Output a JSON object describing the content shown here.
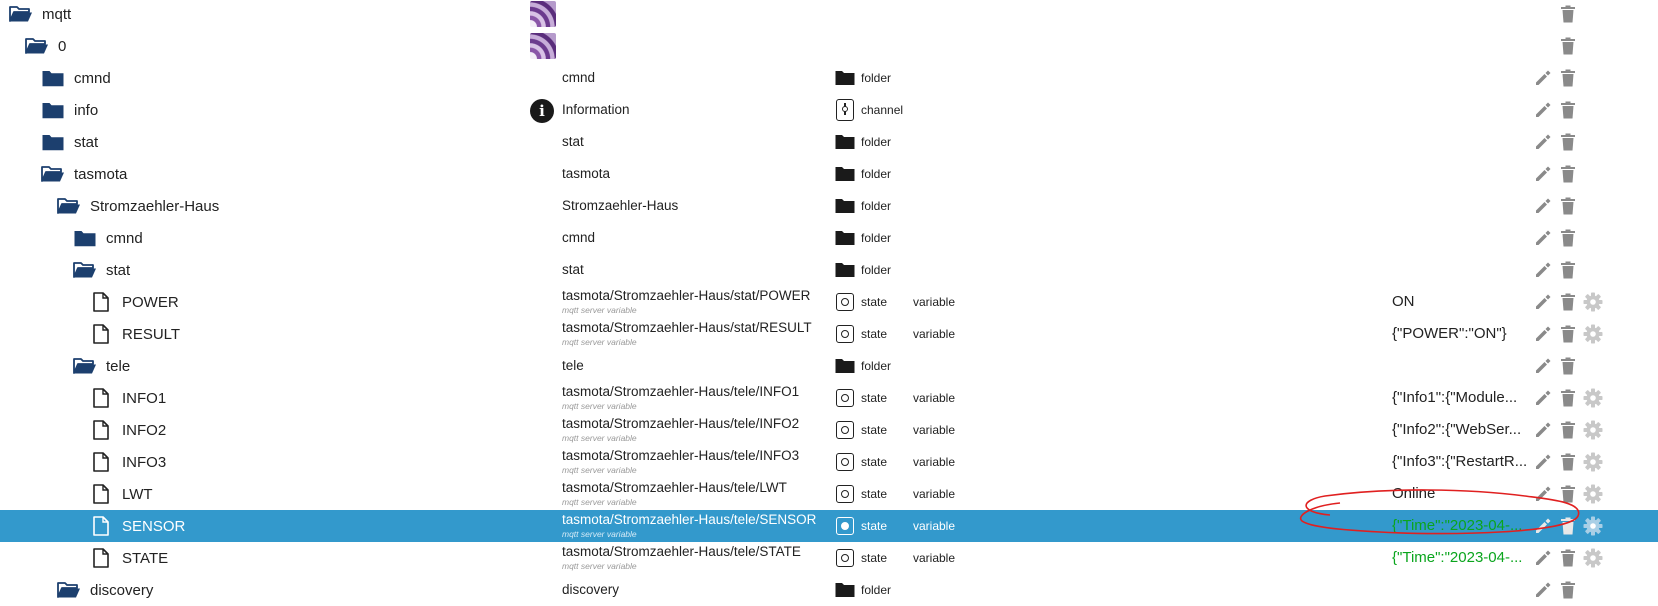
{
  "colors": {
    "folder": "#1c3f6e",
    "selected_row": "#3399cc",
    "value_green": "#0aa51d",
    "action_icon": "#8a8a8a",
    "gear_icon": "#c8c8c8",
    "annotation_red": "#e02020"
  },
  "rows": [
    {
      "id": "mqtt",
      "level": 0,
      "icon": "folder-open-icon",
      "name": "mqtt",
      "obj": {
        "kind": "adapter-image"
      },
      "actions": [
        "delete"
      ]
    },
    {
      "id": "mqtt-0",
      "level": 1,
      "icon": "folder-open-icon",
      "name": "0",
      "obj": {
        "kind": "adapter-image"
      },
      "actions": [
        "delete"
      ]
    },
    {
      "id": "cmnd",
      "level": 2,
      "icon": "folder-icon",
      "name": "cmnd",
      "obj": {
        "kind": "text",
        "name": "cmnd"
      },
      "type": {
        "icon": "folder",
        "label": "folder"
      },
      "actions": [
        "edit",
        "delete"
      ]
    },
    {
      "id": "info",
      "level": 2,
      "icon": "folder-icon",
      "name": "info",
      "obj": {
        "kind": "info",
        "name": "Information"
      },
      "type": {
        "icon": "channel",
        "label": "channel"
      },
      "actions": [
        "edit",
        "delete"
      ]
    },
    {
      "id": "stat",
      "level": 2,
      "icon": "folder-icon",
      "name": "stat",
      "obj": {
        "kind": "text",
        "name": "stat"
      },
      "type": {
        "icon": "folder",
        "label": "folder"
      },
      "actions": [
        "edit",
        "delete"
      ]
    },
    {
      "id": "tasmota",
      "level": 2,
      "icon": "folder-open-icon",
      "name": "tasmota",
      "obj": {
        "kind": "text",
        "name": "tasmota"
      },
      "type": {
        "icon": "folder",
        "label": "folder"
      },
      "actions": [
        "edit",
        "delete"
      ]
    },
    {
      "id": "sz-haus",
      "level": 3,
      "icon": "folder-open-icon",
      "name": "Stromzaehler-Haus",
      "obj": {
        "kind": "text",
        "name": "Stromzaehler-Haus"
      },
      "type": {
        "icon": "folder",
        "label": "folder"
      },
      "actions": [
        "edit",
        "delete"
      ]
    },
    {
      "id": "sz-cmnd",
      "level": 4,
      "icon": "folder-icon",
      "name": "cmnd",
      "obj": {
        "kind": "text",
        "name": "cmnd"
      },
      "type": {
        "icon": "folder",
        "label": "folder"
      },
      "actions": [
        "edit",
        "delete"
      ]
    },
    {
      "id": "sz-stat",
      "level": 4,
      "icon": "folder-open-icon",
      "name": "stat",
      "obj": {
        "kind": "text",
        "name": "stat"
      },
      "type": {
        "icon": "folder",
        "label": "folder"
      },
      "actions": [
        "edit",
        "delete"
      ]
    },
    {
      "id": "power",
      "level": 5,
      "icon": "file-icon",
      "name": "POWER",
      "obj": {
        "kind": "state",
        "name": "tasmota/Stromzaehler-Haus/stat/POWER",
        "sub": "mqtt server variable"
      },
      "type": {
        "icon": "state",
        "label": "state"
      },
      "role": "variable",
      "value": "ON",
      "green": false,
      "actions": [
        "edit",
        "delete",
        "settings"
      ]
    },
    {
      "id": "result",
      "level": 5,
      "icon": "file-icon",
      "name": "RESULT",
      "obj": {
        "kind": "state",
        "name": "tasmota/Stromzaehler-Haus/stat/RESULT",
        "sub": "mqtt server variable"
      },
      "type": {
        "icon": "state",
        "label": "state"
      },
      "role": "variable",
      "value": "{\"POWER\":\"ON\"}",
      "green": false,
      "actions": [
        "edit",
        "delete",
        "settings"
      ]
    },
    {
      "id": "tele",
      "level": 4,
      "icon": "folder-open-icon",
      "name": "tele",
      "obj": {
        "kind": "text",
        "name": "tele"
      },
      "type": {
        "icon": "folder",
        "label": "folder"
      },
      "actions": [
        "edit",
        "delete"
      ]
    },
    {
      "id": "info1",
      "level": 5,
      "icon": "file-icon",
      "name": "INFO1",
      "obj": {
        "kind": "state",
        "name": "tasmota/Stromzaehler-Haus/tele/INFO1",
        "sub": "mqtt server variable"
      },
      "type": {
        "icon": "state",
        "label": "state"
      },
      "role": "variable",
      "value": "{\"Info1\":{\"Module...",
      "green": false,
      "actions": [
        "edit",
        "delete",
        "settings"
      ]
    },
    {
      "id": "info2",
      "level": 5,
      "icon": "file-icon",
      "name": "INFO2",
      "obj": {
        "kind": "state",
        "name": "tasmota/Stromzaehler-Haus/tele/INFO2",
        "sub": "mqtt server variable"
      },
      "type": {
        "icon": "state",
        "label": "state"
      },
      "role": "variable",
      "value": "{\"Info2\":{\"WebSer...",
      "green": false,
      "actions": [
        "edit",
        "delete",
        "settings"
      ]
    },
    {
      "id": "info3",
      "level": 5,
      "icon": "file-icon",
      "name": "INFO3",
      "obj": {
        "kind": "state",
        "name": "tasmota/Stromzaehler-Haus/tele/INFO3",
        "sub": "mqtt server variable"
      },
      "type": {
        "icon": "state",
        "label": "state"
      },
      "role": "variable",
      "value": "{\"Info3\":{\"RestartR...",
      "green": false,
      "actions": [
        "edit",
        "delete",
        "settings"
      ]
    },
    {
      "id": "lwt",
      "level": 5,
      "icon": "file-icon",
      "name": "LWT",
      "obj": {
        "kind": "state",
        "name": "tasmota/Stromzaehler-Haus/tele/LWT",
        "sub": "mqtt server variable"
      },
      "type": {
        "icon": "state",
        "label": "state"
      },
      "role": "variable",
      "value": "Online",
      "green": false,
      "actions": [
        "edit",
        "delete",
        "settings"
      ]
    },
    {
      "id": "sensor",
      "level": 5,
      "icon": "file-icon",
      "name": "SENSOR",
      "selected": true,
      "obj": {
        "kind": "state",
        "name": "tasmota/Stromzaehler-Haus/tele/SENSOR",
        "sub": "mqtt server variable"
      },
      "type": {
        "icon": "state",
        "label": "state"
      },
      "role": "variable",
      "value": "{\"Time\":\"2023-04-...",
      "green": true,
      "actions": [
        "edit",
        "delete",
        "settings"
      ]
    },
    {
      "id": "state",
      "level": 5,
      "icon": "file-icon",
      "name": "STATE",
      "obj": {
        "kind": "state",
        "name": "tasmota/Stromzaehler-Haus/tele/STATE",
        "sub": "mqtt server variable"
      },
      "type": {
        "icon": "state",
        "label": "state"
      },
      "role": "variable",
      "value": "{\"Time\":\"2023-04-...",
      "green": true,
      "actions": [
        "edit",
        "delete",
        "settings"
      ]
    },
    {
      "id": "discovery",
      "level": 3,
      "icon": "folder-open-icon",
      "name": "discovery",
      "obj": {
        "kind": "text",
        "name": "discovery"
      },
      "type": {
        "icon": "folder",
        "label": "folder"
      },
      "actions": [
        "edit",
        "delete"
      ]
    }
  ]
}
